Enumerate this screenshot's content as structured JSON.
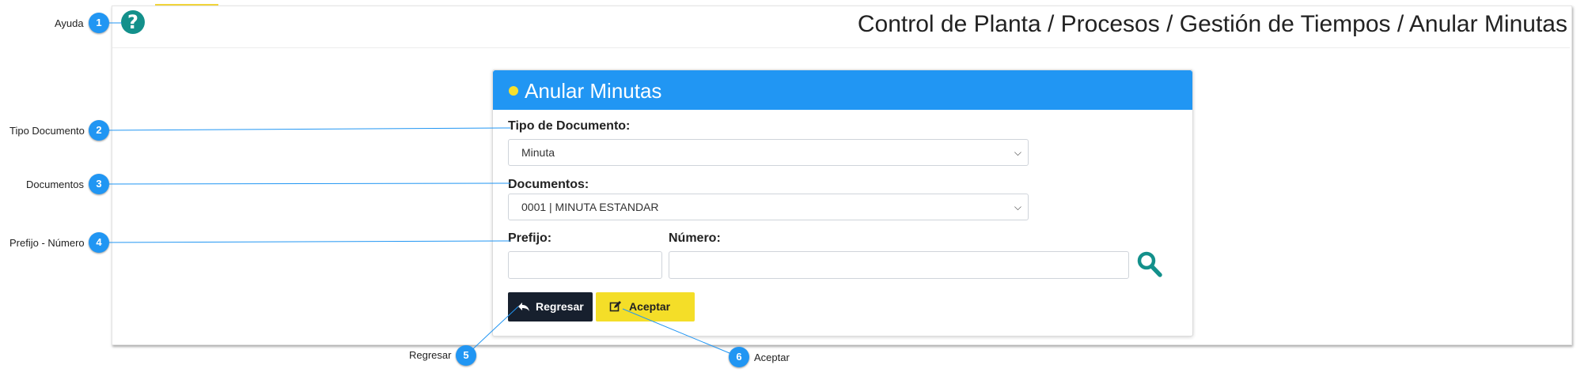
{
  "breadcrumb": "Control de Planta / Procesos / Gestión de Tiempos / Anular Minutas",
  "card": {
    "title": "Anular Minutas",
    "tipo_label": "Tipo de Documento:",
    "tipo_value": "Minuta",
    "documentos_label": "Documentos:",
    "documentos_value": "0001 | MINUTA ESTANDAR",
    "prefijo_label": "Prefijo:",
    "prefijo_value": "",
    "numero_label": "Número:",
    "numero_value": "",
    "regresar_label": "Regresar",
    "aceptar_label": "Aceptar"
  },
  "callouts": [
    {
      "num": "1",
      "label": "Ayuda"
    },
    {
      "num": "2",
      "label": "Tipo Documento"
    },
    {
      "num": "3",
      "label": "Documentos"
    },
    {
      "num": "4",
      "label": "Prefijo - Número"
    },
    {
      "num": "5",
      "label": "Regresar"
    },
    {
      "num": "6",
      "label": "Aceptar"
    }
  ],
  "icons": {
    "help": "question-circle-icon",
    "search": "search-icon",
    "back": "reply-icon",
    "accept": "edit-square-icon",
    "select_arrow": "chevron-down-icon"
  },
  "colors": {
    "header_blue": "#2196f3",
    "accent_yellow": "#f4de28",
    "help_teal": "#13908b",
    "dark_button": "#17202e",
    "callout_blue": "#2196f3"
  }
}
